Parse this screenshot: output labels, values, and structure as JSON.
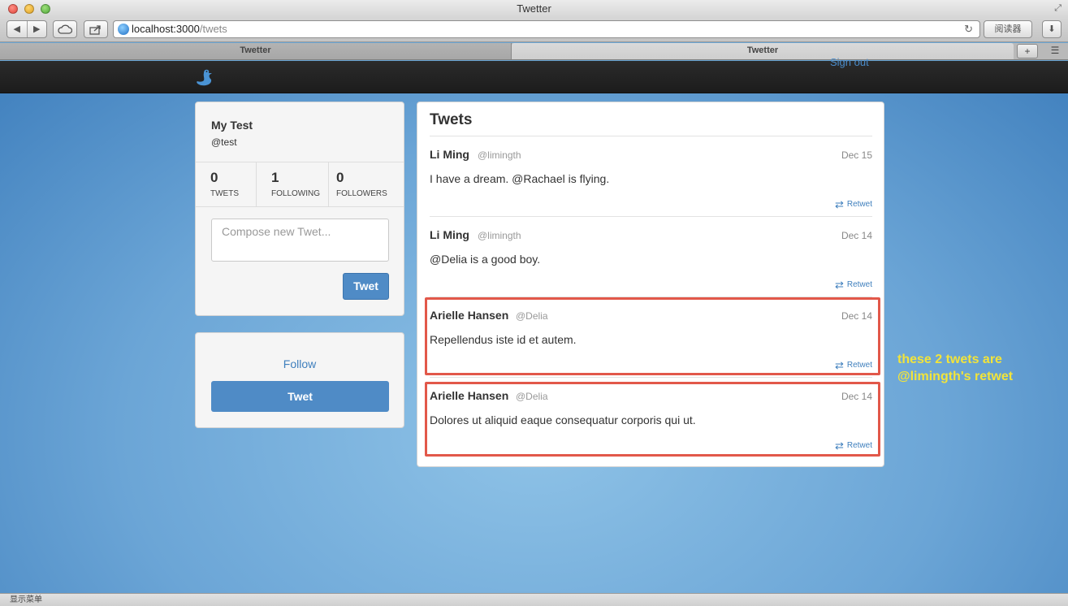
{
  "window": {
    "title": "Twetter"
  },
  "toolbar": {
    "url_host": "localhost:3000",
    "url_path": "/twets",
    "reader_label": "阅读器"
  },
  "tabs": [
    {
      "label": "Twetter"
    },
    {
      "label": "Twetter"
    }
  ],
  "navbar": {
    "signout_label": "Sign out"
  },
  "profile": {
    "name": "My Test",
    "handle": "@test",
    "stats": [
      {
        "value": "0",
        "label": "TWETS"
      },
      {
        "value": "1",
        "label": "FOLLOWING"
      },
      {
        "value": "0",
        "label": "FOLLOWERS"
      }
    ],
    "compose_placeholder": "Compose new Twet...",
    "tweet_button": "Twet"
  },
  "follow_panel": {
    "follow_label": "Follow",
    "tweet_button": "Twet"
  },
  "feed": {
    "title": "Twets",
    "twets": [
      {
        "name": "Li Ming",
        "handle": "@limingth",
        "date": "Dec 15",
        "text": "I have a dream. @Rachael is flying.",
        "retwet": "Retwet"
      },
      {
        "name": "Li Ming",
        "handle": "@limingth",
        "date": "Dec 14",
        "text": "@Delia is a good boy.",
        "retwet": "Retwet"
      },
      {
        "name": "Arielle Hansen",
        "handle": "@Delia",
        "date": "Dec 14",
        "text": "Repellendus iste id et autem.",
        "retwet": "Retwet"
      },
      {
        "name": "Arielle Hansen",
        "handle": "@Delia",
        "date": "Dec 14",
        "text": "Dolores ut aliquid eaque consequatur corporis qui ut.",
        "retwet": "Retwet"
      }
    ]
  },
  "annotation": {
    "line1": "these 2 twets are",
    "line2": "@limingth's retwet"
  },
  "statusbar": {
    "text": "显示菜单"
  },
  "colors": {
    "accent": "#4f8bc6",
    "highlight": "#e2584a",
    "annotation": "#f2e43a",
    "navbar": "#222222"
  }
}
